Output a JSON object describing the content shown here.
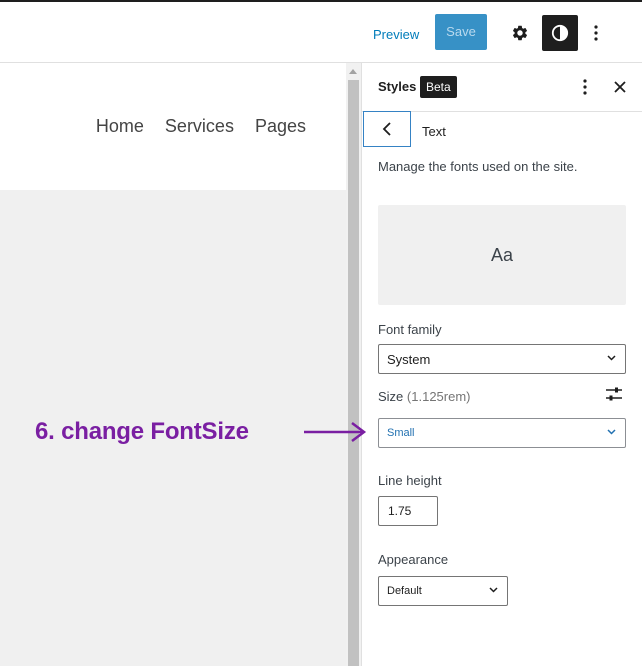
{
  "topbar": {
    "preview_label": "Preview",
    "save_label": "Save",
    "icons": [
      "gear-icon",
      "half-circle-contrast-icon",
      "vertical-ellipsis-icon"
    ]
  },
  "site": {
    "nav": [
      "Home",
      "Services",
      "Pages"
    ]
  },
  "sidebar": {
    "title": "Styles",
    "badge": "Beta",
    "section_title": "Text",
    "description": "Manage the fonts used on the site.",
    "preview_text": "Aa",
    "font_family": {
      "label": "Font family",
      "value": "System"
    },
    "size": {
      "label": "Size",
      "hint": "(1.125rem)",
      "value": "Small"
    },
    "line_height": {
      "label": "Line height",
      "value": "1.75"
    },
    "appearance": {
      "label": "Appearance",
      "value": "Default"
    }
  },
  "annotation": {
    "text": "6.  change FontSize",
    "color": "#7a1fa2"
  },
  "colors": {
    "accent": "#007cba",
    "save_bg": "#3791c6",
    "dark": "#1e1e1e"
  }
}
